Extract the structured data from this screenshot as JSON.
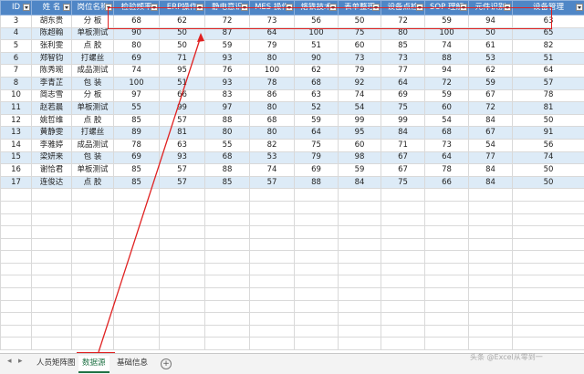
{
  "columns": [
    "ID",
    "姓 名",
    "岗位名称",
    "检验频率",
    "ERP操作",
    "静电意识",
    "MES 操作",
    "烙铁技术",
    "表单整理",
    "设备点检",
    "SOP 理解",
    "元件识别",
    "设备管理"
  ],
  "rows": [
    [
      "3",
      "胡东贵",
      "分 板",
      "68",
      "62",
      "72",
      "73",
      "56",
      "50",
      "72",
      "59",
      "94",
      "63"
    ],
    [
      "4",
      "陈超翰",
      "单板测试",
      "90",
      "50",
      "87",
      "64",
      "100",
      "75",
      "80",
      "100",
      "50",
      "65"
    ],
    [
      "5",
      "张利雯",
      "点 胶",
      "80",
      "50",
      "59",
      "79",
      "51",
      "60",
      "85",
      "74",
      "61",
      "82"
    ],
    [
      "6",
      "郑智钧",
      "打螺丝",
      "69",
      "71",
      "93",
      "80",
      "90",
      "73",
      "73",
      "88",
      "53",
      "51"
    ],
    [
      "7",
      "陈秀琬",
      "成品测试",
      "74",
      "95",
      "76",
      "100",
      "62",
      "79",
      "77",
      "94",
      "62",
      "64"
    ],
    [
      "8",
      "李青芷",
      "包 装",
      "100",
      "51",
      "93",
      "78",
      "68",
      "92",
      "64",
      "72",
      "59",
      "57"
    ],
    [
      "10",
      "简志雪",
      "分 板",
      "97",
      "66",
      "83",
      "86",
      "63",
      "74",
      "69",
      "59",
      "67",
      "78"
    ],
    [
      "11",
      "赵若晨",
      "单板测试",
      "55",
      "99",
      "97",
      "80",
      "52",
      "54",
      "75",
      "60",
      "72",
      "81"
    ],
    [
      "12",
      "姚哲维",
      "点 胶",
      "85",
      "57",
      "88",
      "68",
      "59",
      "99",
      "99",
      "54",
      "84",
      "50"
    ],
    [
      "13",
      "黄静雯",
      "打螺丝",
      "89",
      "81",
      "80",
      "80",
      "64",
      "95",
      "84",
      "68",
      "67",
      "91"
    ],
    [
      "14",
      "李雅婷",
      "成品测试",
      "78",
      "63",
      "55",
      "82",
      "75",
      "60",
      "71",
      "73",
      "54",
      "56"
    ],
    [
      "15",
      "梁妍来",
      "包 装",
      "69",
      "93",
      "68",
      "53",
      "79",
      "98",
      "67",
      "64",
      "77",
      "74"
    ],
    [
      "16",
      "谢恰君",
      "单板测试",
      "85",
      "57",
      "88",
      "74",
      "69",
      "59",
      "67",
      "78",
      "84",
      "50"
    ],
    [
      "17",
      "连俊达",
      "点 胶",
      "85",
      "57",
      "85",
      "57",
      "88",
      "84",
      "75",
      "66",
      "84",
      "50"
    ]
  ],
  "sheet_tabs": [
    "人员矩阵图",
    "数据源",
    "基础信息"
  ],
  "active_tab": "数据源",
  "nav": {
    "prev": "◂",
    "next": "▸",
    "add": "+"
  },
  "watermark": "头条 @Excel从零到一",
  "colors": {
    "header_bg": "#4f86c6",
    "band": "#ddebf7",
    "annotation": "#e02020",
    "active_tab_text": "#217346"
  }
}
